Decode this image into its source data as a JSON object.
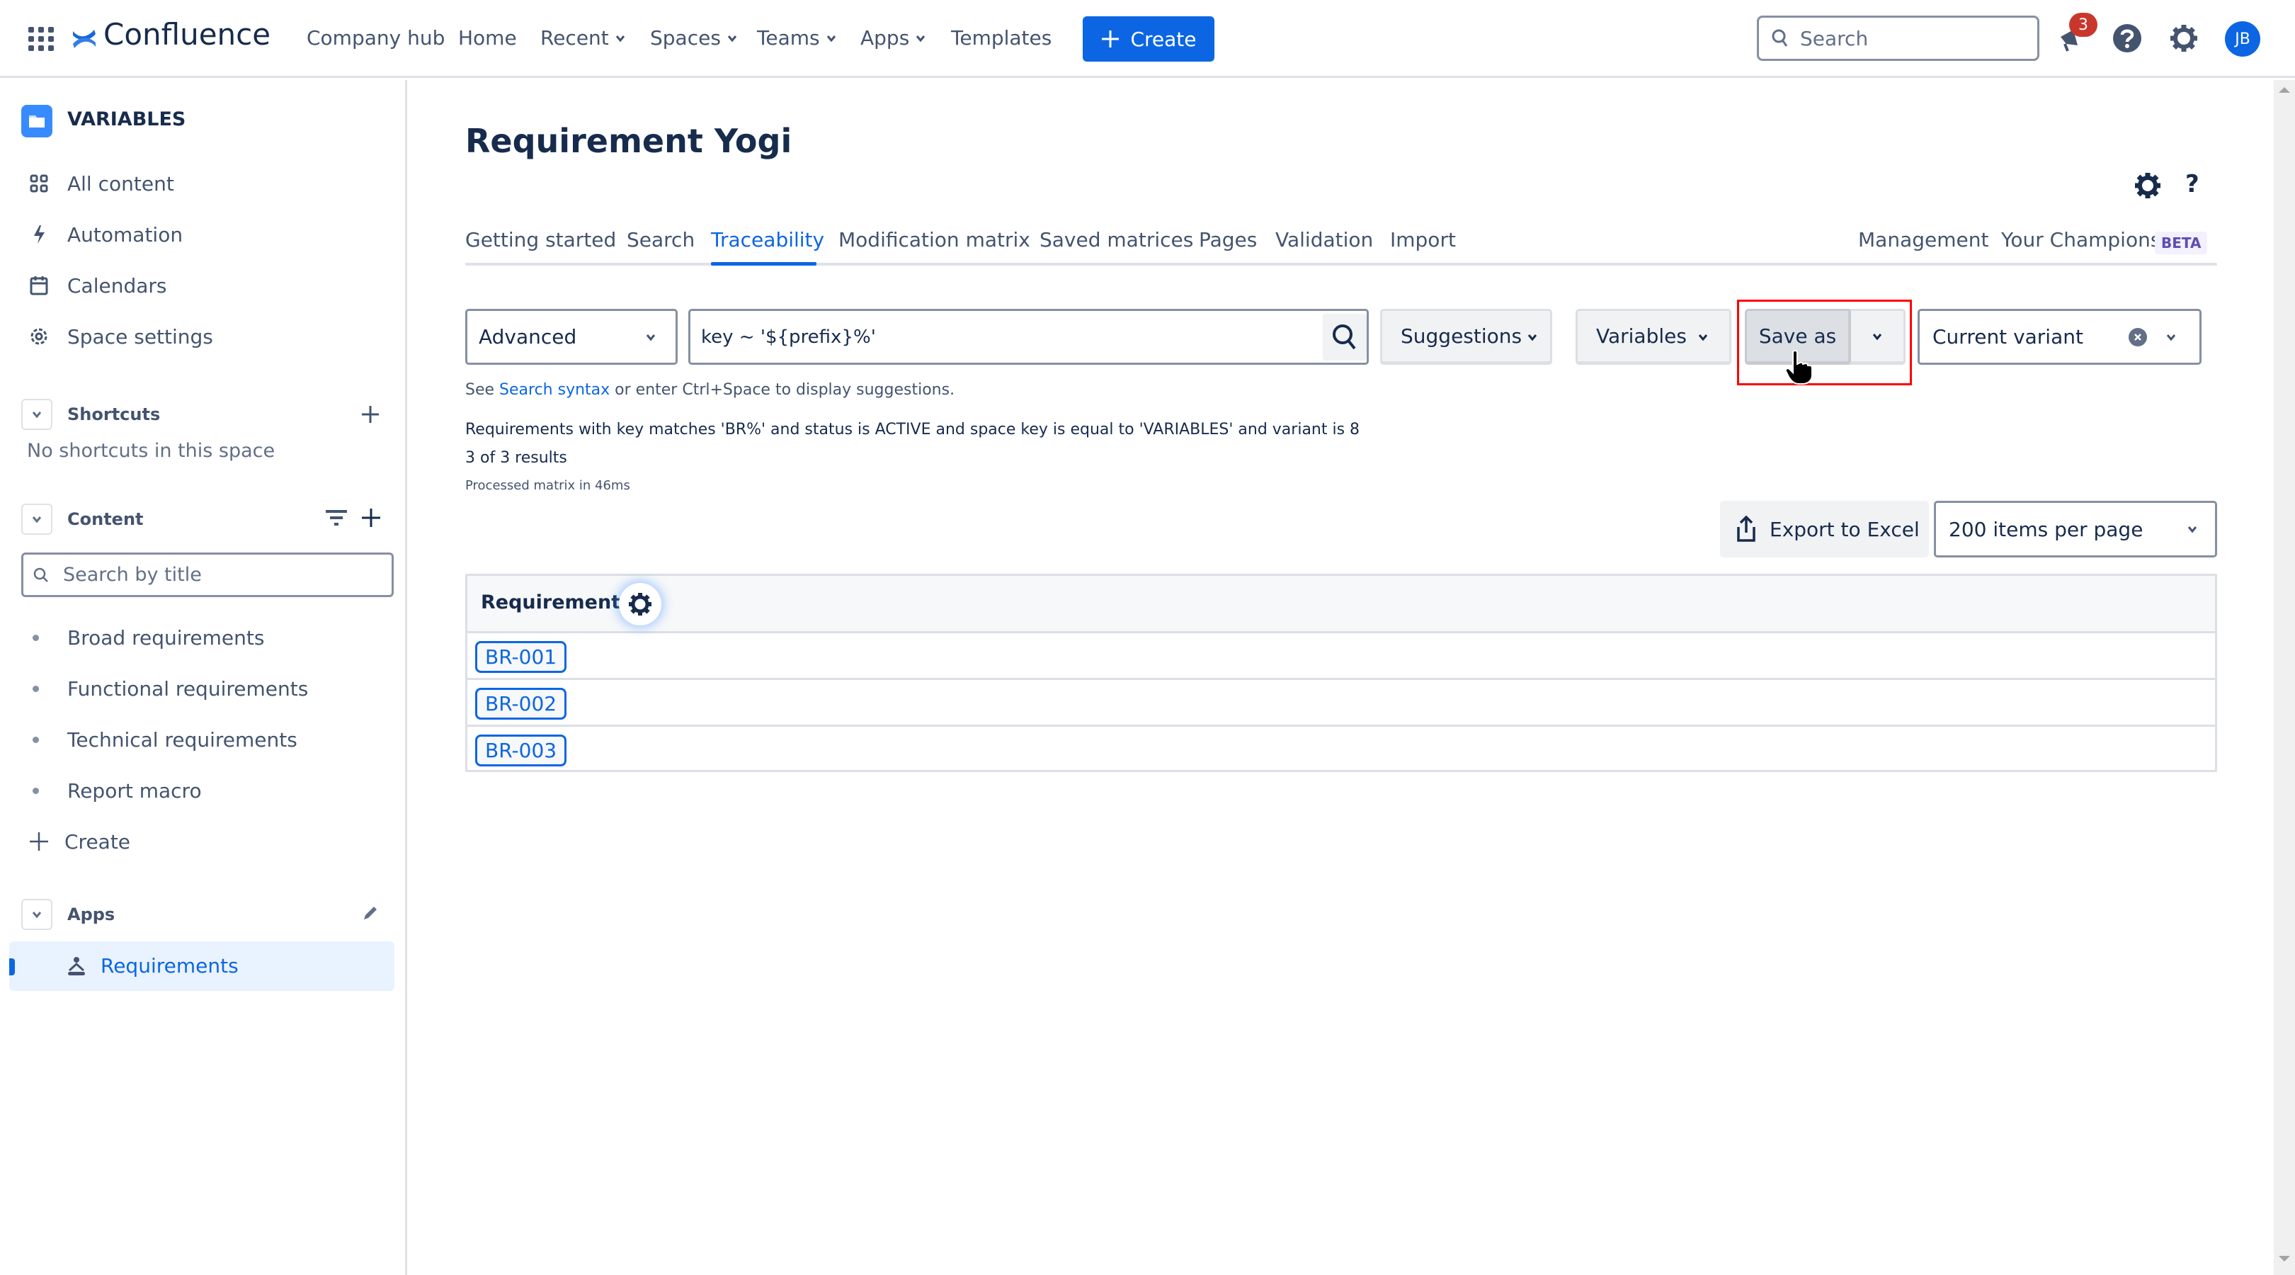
{
  "topbar": {
    "app_name": "Confluence",
    "nav": [
      {
        "label": "Company hub",
        "has_menu": false
      },
      {
        "label": "Home",
        "has_menu": false
      },
      {
        "label": "Recent",
        "has_menu": true
      },
      {
        "label": "Spaces",
        "has_menu": true
      },
      {
        "label": "Teams",
        "has_menu": true
      },
      {
        "label": "Apps",
        "has_menu": true
      },
      {
        "label": "Templates",
        "has_menu": false
      }
    ],
    "create_label": "Create",
    "search_placeholder": "Search",
    "notification_count": "3",
    "avatar_initials": "JB",
    "icons": [
      "app-switcher-icon",
      "confluence-logo-icon",
      "search-icon",
      "notifications-megaphone-icon",
      "help-icon",
      "settings-gear-icon"
    ]
  },
  "sidebar": {
    "space_name": "VARIABLES",
    "space_icon": "folder-icon",
    "items": [
      {
        "label": "All content",
        "icon": "grid-icon"
      },
      {
        "label": "Automation",
        "icon": "lightning-icon"
      },
      {
        "label": "Calendars",
        "icon": "calendar-icon"
      },
      {
        "label": "Space settings",
        "icon": "gear-icon"
      }
    ],
    "shortcuts": {
      "title": "Shortcuts",
      "empty_text": "No shortcuts in this space"
    },
    "content": {
      "title": "Content",
      "search_placeholder": "Search by title",
      "pages": [
        {
          "label": "Broad requirements"
        },
        {
          "label": "Functional requirements"
        },
        {
          "label": "Technical requirements"
        },
        {
          "label": "Report macro"
        }
      ],
      "create_label": "Create"
    },
    "apps": {
      "title": "Apps",
      "items": [
        {
          "label": "Requirements",
          "active": true,
          "icon": "requirement-yogi-icon"
        }
      ]
    }
  },
  "main": {
    "title": "Requirement Yogi",
    "tabs": [
      {
        "label": "Getting started",
        "active": false
      },
      {
        "label": "Search",
        "active": false
      },
      {
        "label": "Traceability",
        "active": true
      },
      {
        "label": "Modification matrix",
        "active": false
      },
      {
        "label": "Saved matrices",
        "active": false
      },
      {
        "label": "Pages",
        "active": false
      },
      {
        "label": "Validation",
        "active": false
      },
      {
        "label": "Import",
        "active": false
      }
    ],
    "right_tabs": [
      {
        "label": "Management"
      },
      {
        "label": "Your Champions",
        "badge": "BETA"
      }
    ],
    "query": {
      "mode": "Advanced",
      "value": "key ~ '${prefix}%'",
      "suggestions_label": "Suggestions",
      "variables_label": "Variables",
      "save_as_label": "Save as",
      "variant_value": "Current variant"
    },
    "help": {
      "prefix": "See ",
      "link": "Search syntax",
      "suffix": " or enter Ctrl+Space to display suggestions."
    },
    "results": {
      "description": "Requirements with key matches 'BR%' and status is ACTIVE and space key is equal to 'VARIABLES' and variant is 8",
      "count": "3 of 3 results",
      "timing": "Processed matrix in 46ms"
    },
    "export_label": "Export to Excel",
    "page_size": "200 items per page",
    "table": {
      "column_header": "Requirements",
      "rows": [
        {
          "key": "BR-001"
        },
        {
          "key": "BR-002"
        },
        {
          "key": "BR-003"
        }
      ]
    }
  },
  "colors": {
    "brand_blue": "#0c66e4",
    "text_primary": "#172b4d",
    "text_secondary": "#44546f",
    "badge_red": "#c9372c",
    "beta_purple": "#5e4db2",
    "highlight_red": "#ff0000"
  }
}
